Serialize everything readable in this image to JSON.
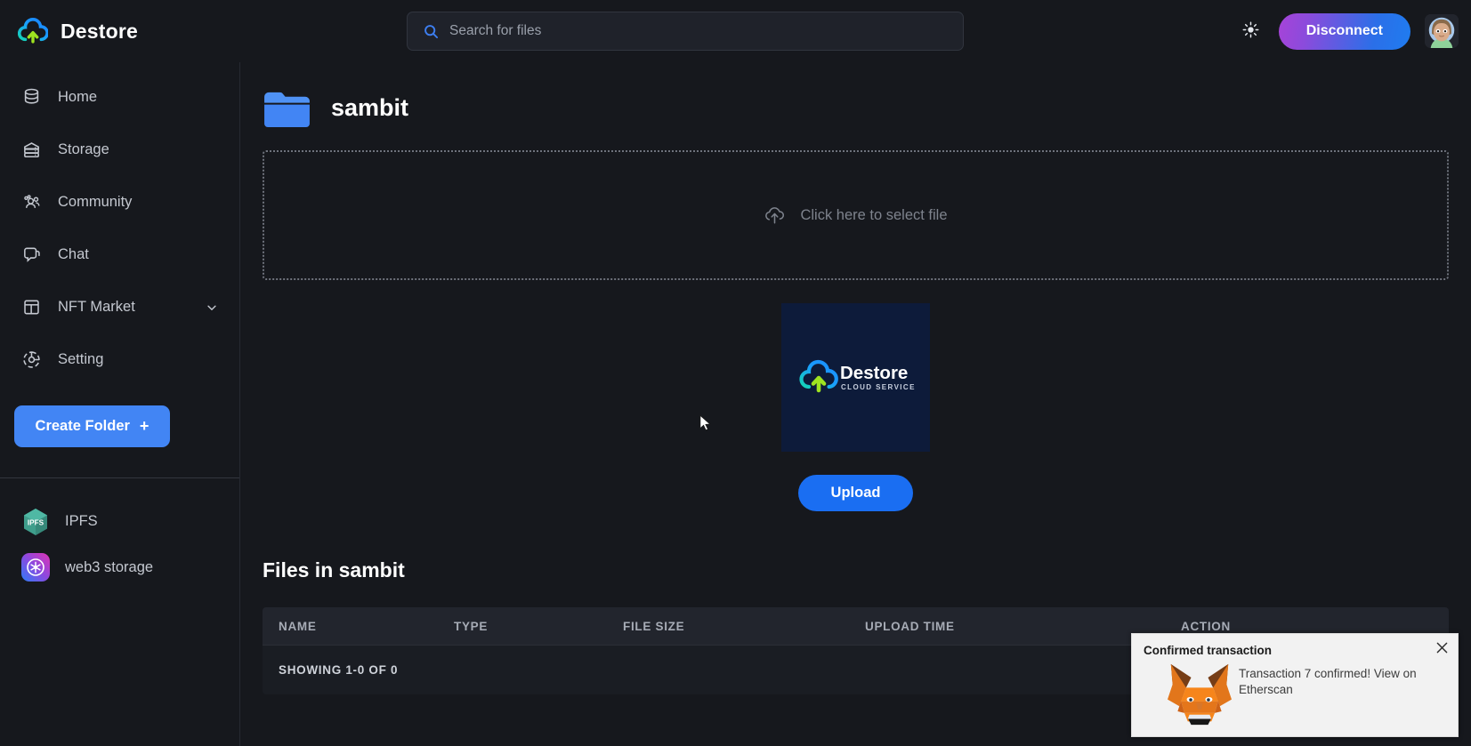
{
  "brand": {
    "name": "Destore",
    "logo_icon": "cloud-upload-logo"
  },
  "search": {
    "placeholder": "Search for files",
    "value": "",
    "icon": "search-icon"
  },
  "header": {
    "theme_toggle_icon": "sun-icon",
    "disconnect_label": "Disconnect",
    "avatar_icon": "user-avatar"
  },
  "sidebar": {
    "items": [
      {
        "label": "Home",
        "icon": "database-icon",
        "has_chevron": false
      },
      {
        "label": "Storage",
        "icon": "server-icon",
        "has_chevron": false
      },
      {
        "label": "Community",
        "icon": "people-icon",
        "has_chevron": false
      },
      {
        "label": "Chat",
        "icon": "chat-bubble-icon",
        "has_chevron": false
      },
      {
        "label": "NFT Market",
        "icon": "layout-grid-icon",
        "has_chevron": true
      },
      {
        "label": "Setting",
        "icon": "gear-icon",
        "has_chevron": false
      }
    ],
    "create_folder_label": "Create Folder",
    "create_folder_plus": "+",
    "storage_providers": [
      {
        "label": "IPFS",
        "icon": "ipfs-hexagon-icon",
        "badge_text": "IPFS"
      },
      {
        "label": "web3 storage",
        "icon": "web3-storage-icon",
        "badge_text": ""
      }
    ]
  },
  "main": {
    "folder_name": "sambit",
    "folder_icon": "folder-icon",
    "dropzone": {
      "label": "Click here to select file",
      "icon": "cloud-upload-icon"
    },
    "preview": {
      "logo_text": "Destore",
      "logo_subtext": "CLOUD SERVICE"
    },
    "upload_label": "Upload",
    "files_section_title": "Files in sambit",
    "table": {
      "columns": [
        "NAME",
        "TYPE",
        "FILE SIZE",
        "UPLOAD TIME",
        "ACTION"
      ],
      "rows": [],
      "showing_text": "SHOWING 1-0 OF 0"
    }
  },
  "notification": {
    "title": "Confirmed transaction",
    "message": "Transaction 7 confirmed! View on Etherscan",
    "icon": "metamask-fox-icon",
    "close_icon": "close-icon"
  },
  "colors": {
    "background": "#16181d",
    "panel": "#1f222a",
    "accent_blue": "#4285f4",
    "upload_blue": "#1a6ef2",
    "gradient_start": "#a743d8",
    "gradient_end": "#1f7cf0",
    "text_primary": "#ffffff",
    "text_muted": "#9aa0ab",
    "folder_blue": "#4285f4",
    "logo_green": "#9fe320",
    "logo_blue": "#1a9cff",
    "metamask_orange": "#e2761b"
  }
}
